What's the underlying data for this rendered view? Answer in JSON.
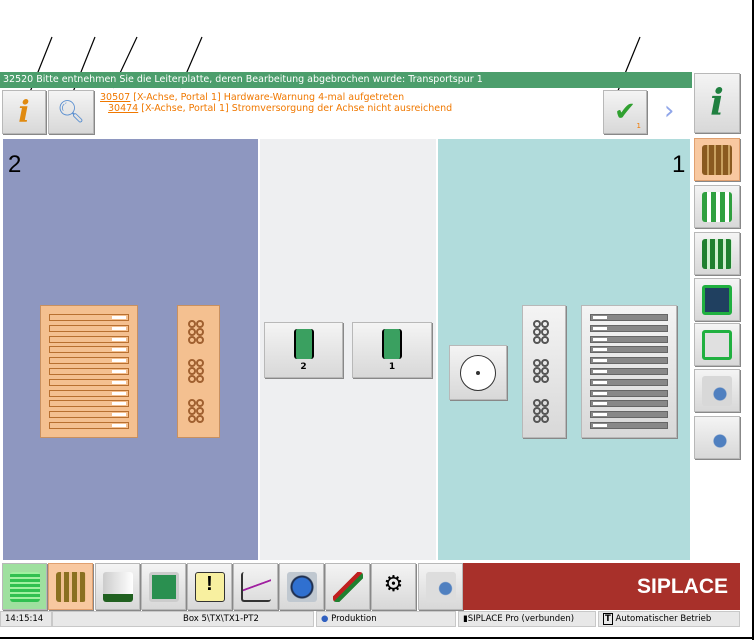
{
  "message_bar": {
    "text": "32520 Bitte entnehmen Sie die Leiterplatte, deren Bearbeitung abgebrochen wurde: Transportspur 1"
  },
  "messages": [
    {
      "code": "30507",
      "text": " [X-Achse, Portal 1] Hardware-Warnung 4-mal aufgetreten"
    },
    {
      "code": "30474",
      "text": " [X-Achse, Portal 1] Stromversorgung der Achse nicht ausreichend"
    }
  ],
  "acknowledge": {
    "count": "1"
  },
  "panels": {
    "left_label": "2",
    "right_label": "1"
  },
  "conveyor": [
    {
      "label": "2"
    },
    {
      "label": "1"
    }
  ],
  "brand": "SIPLACE",
  "status_bar": {
    "time": "14:15:14",
    "path": "Box 5\\TX\\TX1-PT2",
    "user": "Produktion",
    "connection": "SIPLACE Pro (verbunden)",
    "mode": "Automatischer Betrieb"
  },
  "colors": {
    "message_bar": "#4c9e6c",
    "message_text": "#f07800",
    "left_panel": "#8e97c0",
    "right_panel": "#b1dcdc",
    "brand_bg": "#a8302a",
    "active": "#f8c8a0"
  }
}
